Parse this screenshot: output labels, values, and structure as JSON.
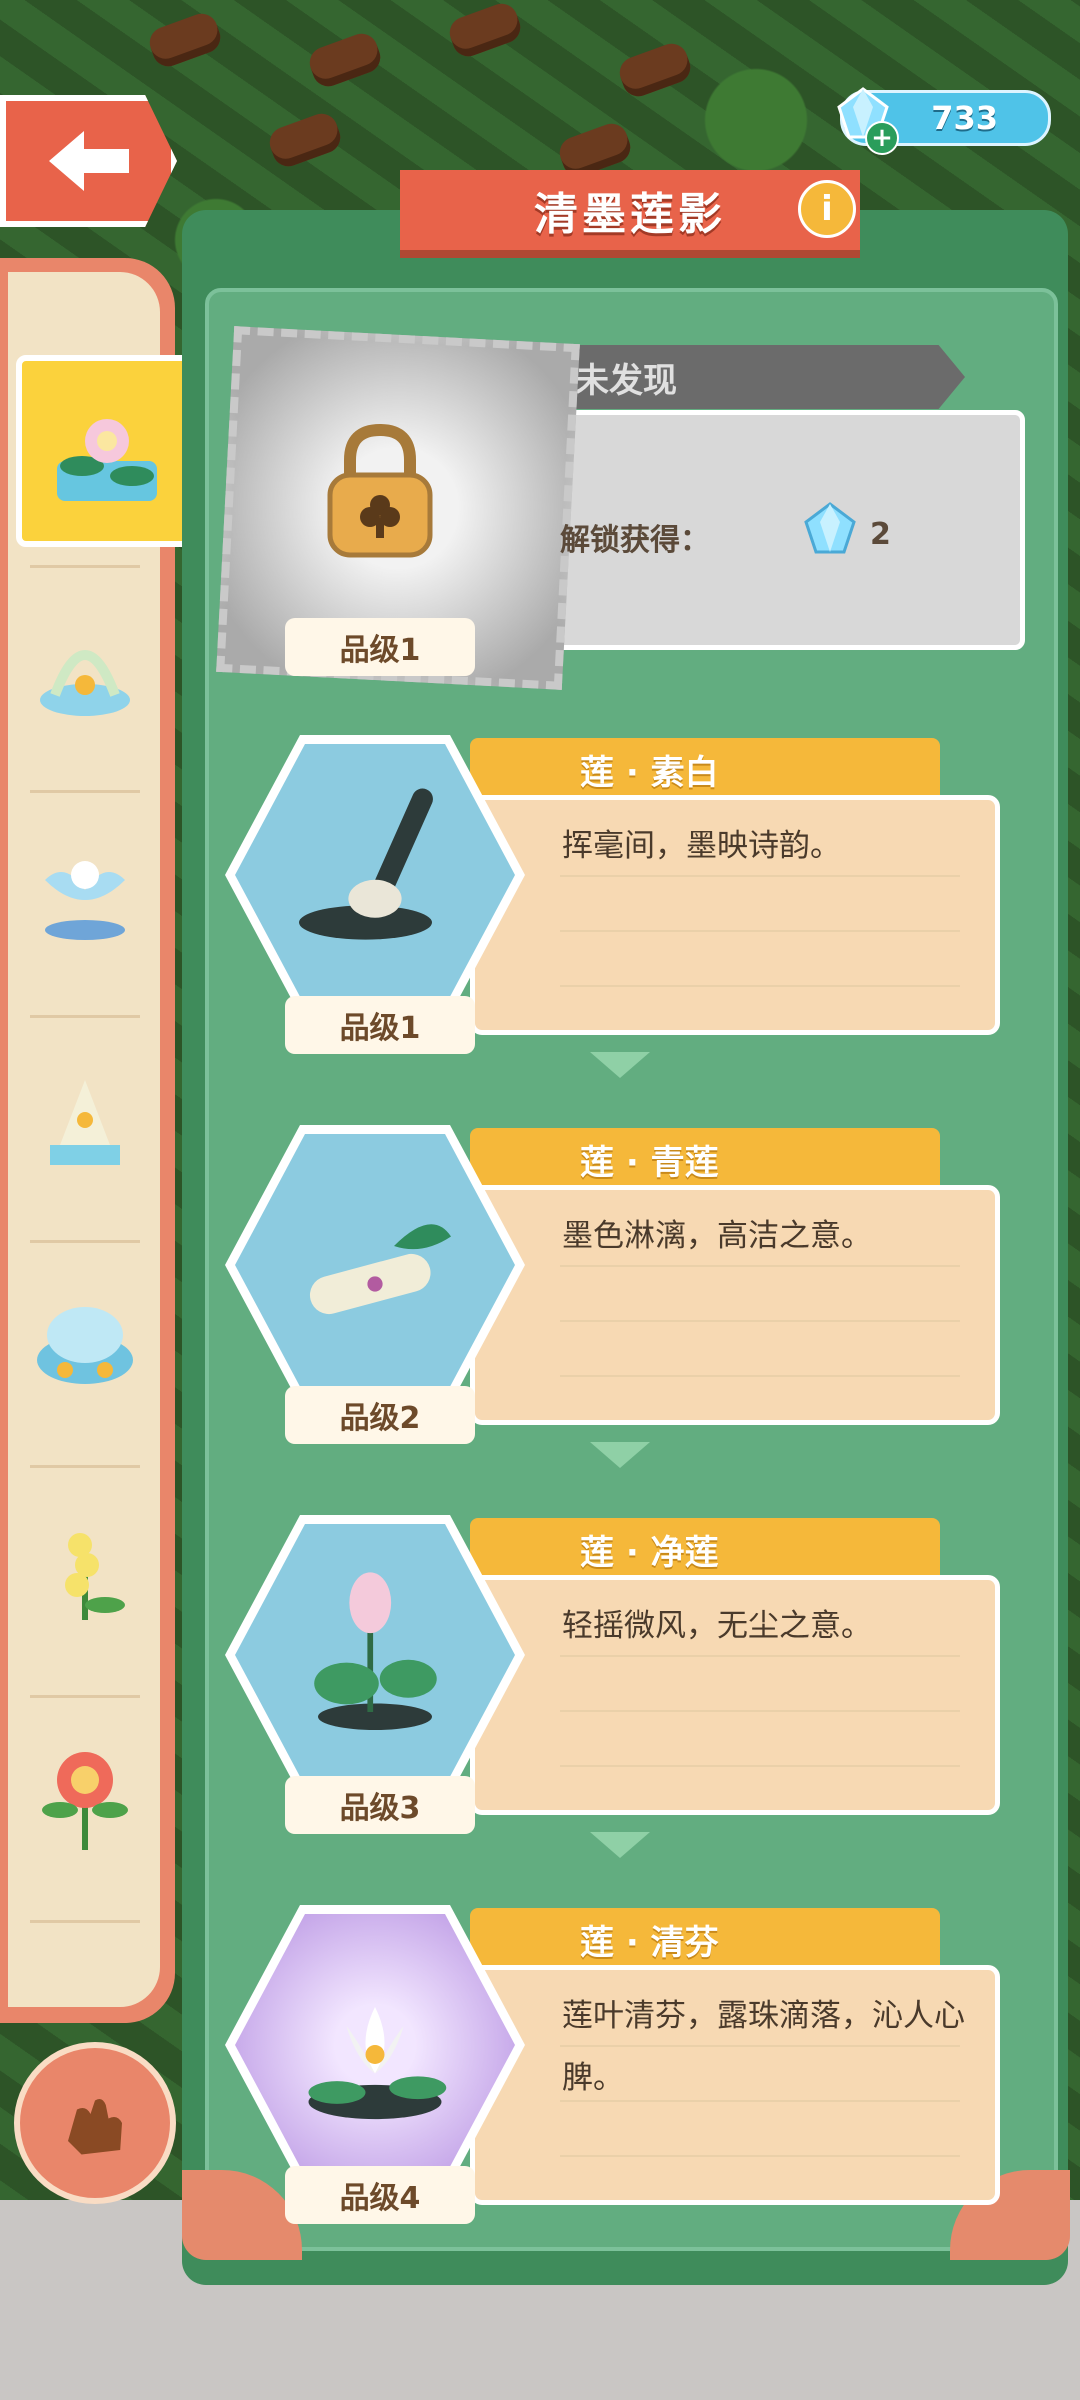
{
  "currency": {
    "value": "733",
    "icon": "gem-icon"
  },
  "title": "清墨莲影",
  "locked": {
    "status": "未发现",
    "unlock_label": "解锁获得：",
    "reward_count": "2",
    "grade": "品级1"
  },
  "items": [
    {
      "name": "莲 · 素白",
      "desc": "挥毫间，墨映诗韵。",
      "grade": "品级1"
    },
    {
      "name": "莲 · 青莲",
      "desc": "墨色淋漓，高洁之意。",
      "grade": "品级2"
    },
    {
      "name": "莲 · 净莲",
      "desc": "轻摇微风，无尘之意。",
      "grade": "品级3"
    },
    {
      "name": "莲 · 清芬",
      "desc": "莲叶清芬，露珠滴落，沁人心脾。",
      "grade": "品级4"
    }
  ],
  "colors": {
    "accent_red": "#e8634a",
    "panel_green": "#3f8c5b",
    "card_orange": "#f5b83a",
    "card_body": "#f7d9b3"
  }
}
